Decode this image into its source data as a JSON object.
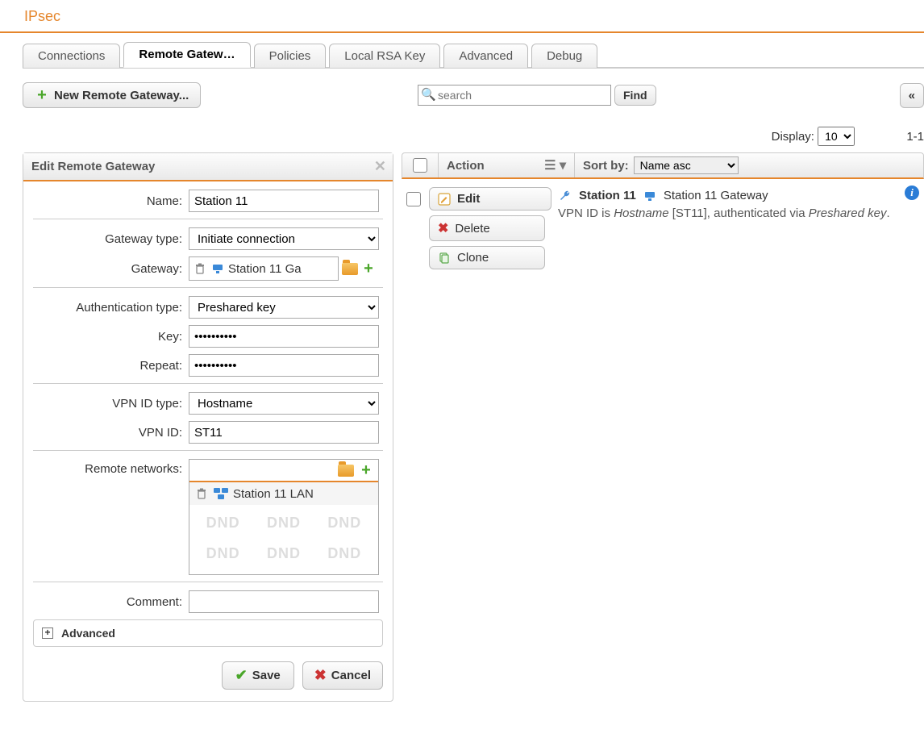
{
  "page_title": "IPsec",
  "tabs": {
    "connections": "Connections",
    "remote_gw": "Remote Gatew…",
    "policies": "Policies",
    "local_rsa": "Local RSA Key",
    "advanced": "Advanced",
    "debug": "Debug"
  },
  "toolbar": {
    "new_remote": "New Remote Gateway...",
    "search_placeholder": "search",
    "find": "Find",
    "prev": "«"
  },
  "display": {
    "label": "Display:",
    "value": "10",
    "range": "1-1"
  },
  "form": {
    "panel_title": "Edit Remote Gateway",
    "name_label": "Name:",
    "name_value": "Station 11",
    "gwtype_label": "Gateway type:",
    "gwtype_value": "Initiate connection",
    "gateway_label": "Gateway:",
    "gateway_obj": "Station 11 Ga",
    "auth_label": "Authentication type:",
    "auth_value": "Preshared key",
    "key_label": "Key:",
    "key_value": "••••••••••",
    "repeat_label": "Repeat:",
    "repeat_value": "••••••••••",
    "vpnidtype_label": "VPN ID type:",
    "vpnidtype_value": "Hostname",
    "vpnid_label": "VPN ID:",
    "vpnid_value": "ST11",
    "remote_label": "Remote networks:",
    "remote_item": "Station 11 LAN",
    "dnd": "DND",
    "comment_label": "Comment:",
    "comment_value": "",
    "advanced_label": "Advanced",
    "save": "Save",
    "cancel": "Cancel"
  },
  "list": {
    "action_label": "Action",
    "sort_label": "Sort by:",
    "sort_value": "Name asc",
    "actions": {
      "edit": "Edit",
      "delete": "Delete",
      "clone": "Clone"
    },
    "item": {
      "name": "Station 11",
      "host": "Station 11 Gateway",
      "desc_pre": "VPN ID is ",
      "desc_em1": "Hostname",
      "desc_mid": " [ST11], authenticated via ",
      "desc_em2": "Preshared key",
      "desc_end": "."
    }
  }
}
